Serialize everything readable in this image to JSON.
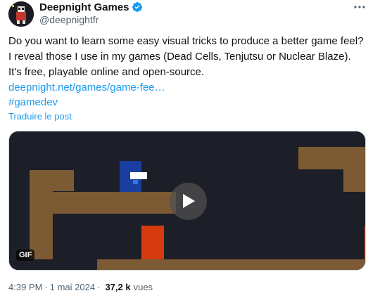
{
  "author": {
    "display_name": "Deepnight Games",
    "handle": "@deepnightfr",
    "verified": true
  },
  "post": {
    "text": "Do you want to learn some easy visual tricks to produce a better game feel? I reveal those I use in my games (Dead Cells, Tenjutsu or Nuclear Blaze). It's free, playable online and open-source.",
    "link": "deepnight.net/games/game-fee…",
    "hashtag": "#gamedev",
    "translate_label": "Traduire le post"
  },
  "media": {
    "badge": "GIF"
  },
  "meta": {
    "time": "4:39 PM",
    "date": "1 mai 2024",
    "separator": "·",
    "views_count": "37,2 k",
    "views_label": "vues"
  },
  "colors": {
    "link": "#1d9bf0",
    "verified": "#1d9bf0",
    "secondary_text": "#536471",
    "scene_bg": "#1c1f27",
    "ground": "#7b5a34",
    "player": "#1a3fa0",
    "hazard": "#d63b0f"
  },
  "icons": {
    "verified": "verified-badge-icon",
    "more": "more-horizontal-icon",
    "play": "play-icon"
  }
}
